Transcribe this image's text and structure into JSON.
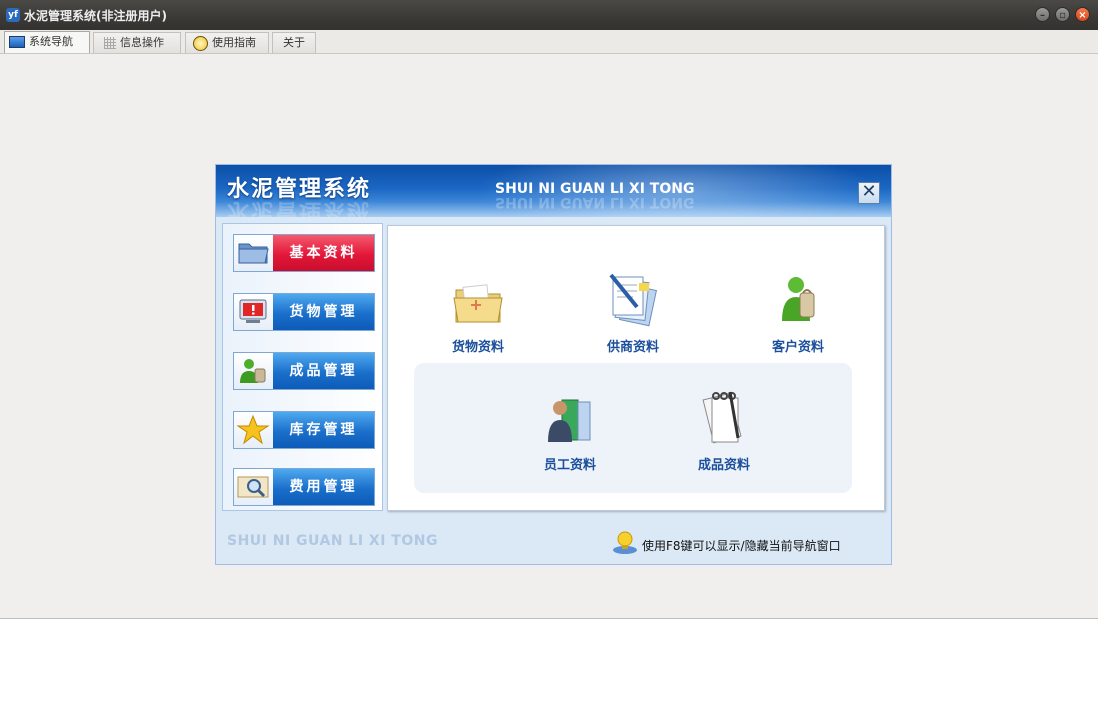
{
  "window": {
    "title": "水泥管理系统(非注册用户)",
    "app_icon": "yf-logo-icon"
  },
  "tabs": [
    {
      "label": "系统导航",
      "icon": "nav-screen-icon",
      "active": true
    },
    {
      "label": "信息操作",
      "icon": "grid-icon",
      "active": false
    },
    {
      "label": "使用指南",
      "icon": "guide-icon",
      "active": false
    },
    {
      "label": "关于",
      "icon": "",
      "active": false
    }
  ],
  "panel": {
    "title": "水泥管理系统",
    "subtitle": "SHUI NI GUAN LI XI TONG",
    "footer_text": "SHUI NI GUAN LI XI TONG",
    "tip": "使用F8键可以显示/隐藏当前导航窗口",
    "close_symbol": "✕"
  },
  "nav_buttons": [
    {
      "label": "基本资料",
      "icon": "folder-icon",
      "selected": true
    },
    {
      "label": "货物管理",
      "icon": "monitor-alert-icon",
      "selected": false
    },
    {
      "label": "成品管理",
      "icon": "user-bag-icon",
      "selected": false
    },
    {
      "label": "库存管理",
      "icon": "star-icon",
      "selected": false
    },
    {
      "label": "费用管理",
      "icon": "magnifier-icon",
      "selected": false
    }
  ],
  "content_items": [
    {
      "label": "货物资料",
      "icon": "folder-open-icon"
    },
    {
      "label": "供商资料",
      "icon": "documents-pen-icon"
    },
    {
      "label": "客户资料",
      "icon": "customer-bag-icon"
    },
    {
      "label": "员工资料",
      "icon": "employee-book-icon"
    },
    {
      "label": "成品资料",
      "icon": "notebook-icon"
    }
  ],
  "colors": {
    "banner": "#1b67c4",
    "selected_button": "#e3173a",
    "normal_button": "#1a6fcb",
    "item_label": "#1b4f9c"
  }
}
